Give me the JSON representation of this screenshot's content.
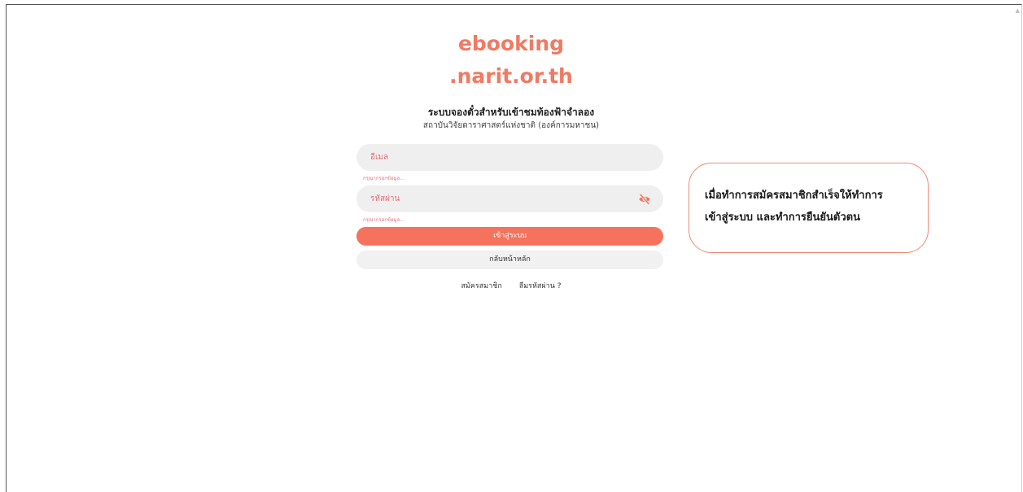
{
  "logo": {
    "line1": "ebooking",
    "line2": ".narit.or.th"
  },
  "header": {
    "title": "ระบบจองตั๋วสำหรับเข้าชมท้องฟ้าจำลอง",
    "subtitle": "สถาบันวิจัยดาราศาสตร์แห่งชาติ (องค์การมหาชน)"
  },
  "form": {
    "email_placeholder": "อีเมล",
    "email_error": "กรุณากรอกข้อมูล...",
    "password_placeholder": "รหัสผ่าน",
    "password_error": "กรุณากรอกข้อมูล...",
    "password_toggle_icon": "eye-slash-icon",
    "login_label": "เข้าสู่ระบบ",
    "home_label": "กลับหน้าหลัก"
  },
  "links": {
    "register": "สมัครสมาชิก",
    "forgot_password": "ลืมรหัสผ่าน ?"
  },
  "callout": {
    "line1": "เมื่อทำการสมัครสมาชิกสำเร็จให้ทำการ",
    "line2": "เข้าสู่ระบบ และทำการยืนยันตัวตน"
  },
  "colors": {
    "brand": "#f07a63",
    "primary_button": "#f5735c",
    "error": "#e0707a",
    "field_bg": "#efefef",
    "callout_border": "#ef8b78"
  }
}
